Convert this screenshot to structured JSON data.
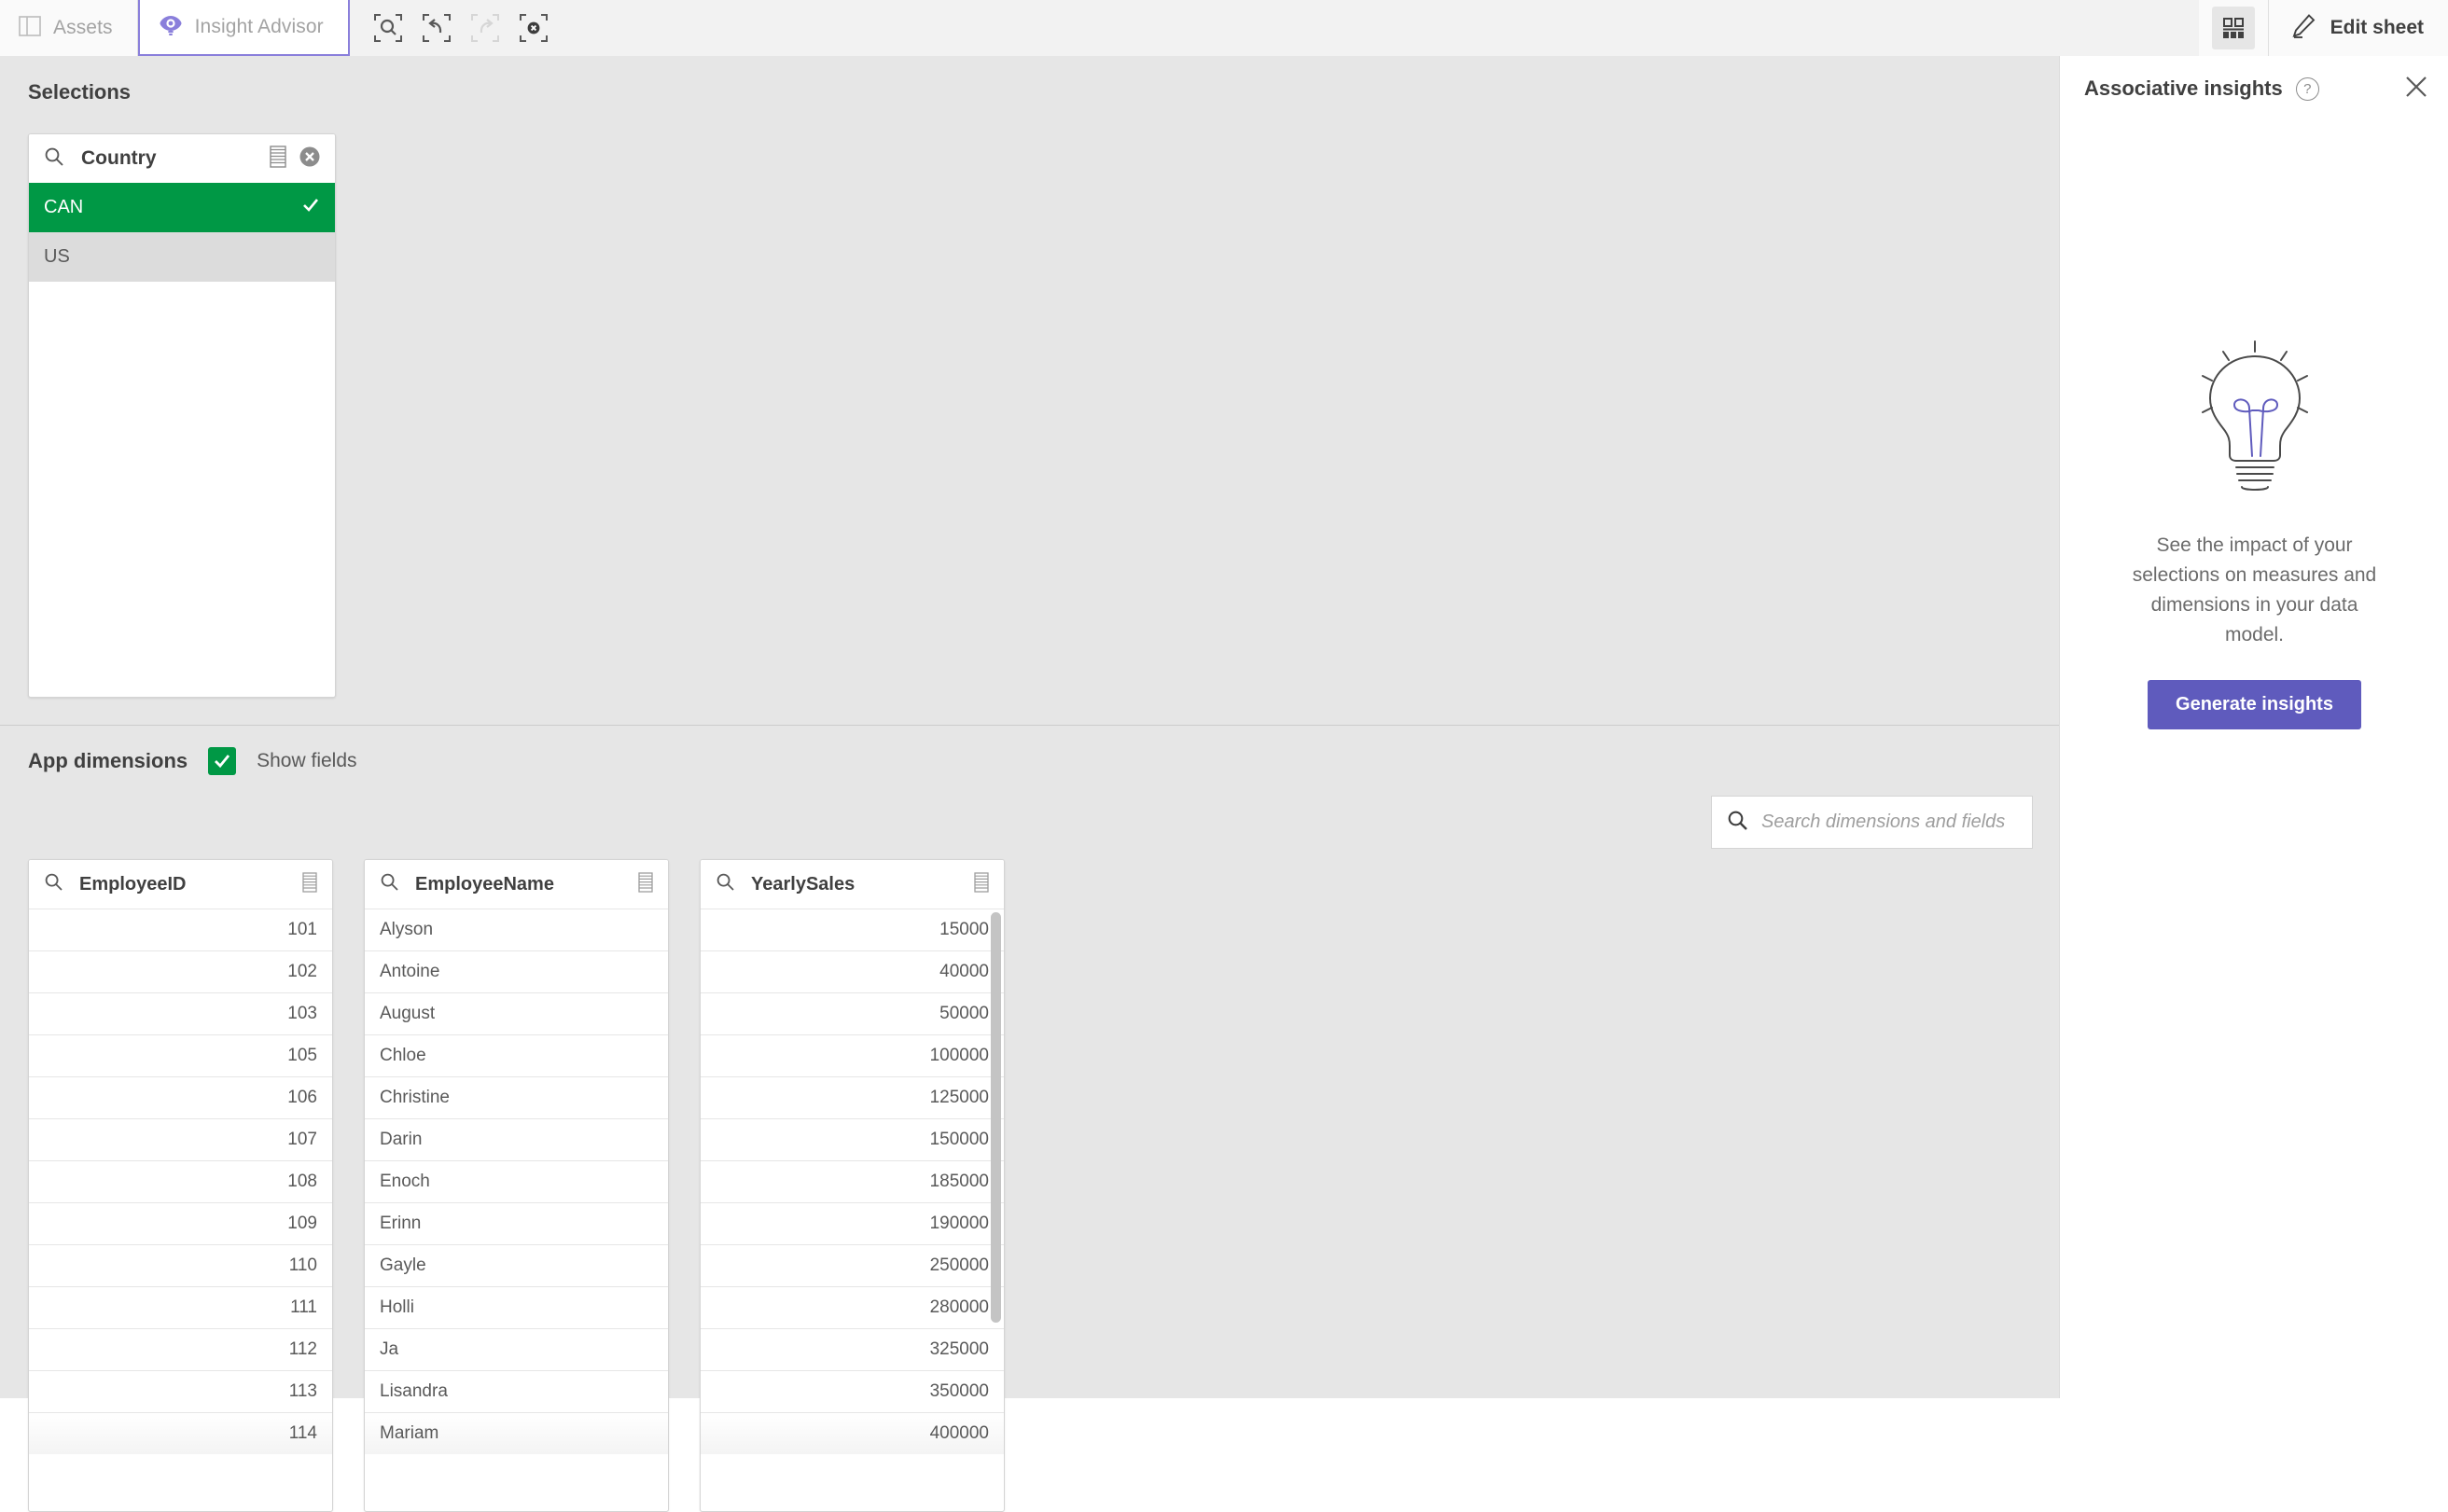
{
  "toolbar": {
    "tabs": [
      {
        "label": "Assets",
        "icon": "panel-icon",
        "active": false
      },
      {
        "label": "Insight Advisor",
        "icon": "insight-advisor-icon",
        "active": true
      }
    ],
    "selection_actions": [
      {
        "name": "selection-search",
        "icon": "search-in-selection-icon",
        "enabled": true
      },
      {
        "name": "step-back",
        "icon": "undo-icon",
        "enabled": true
      },
      {
        "name": "step-forward",
        "icon": "redo-icon",
        "enabled": false
      },
      {
        "name": "clear-selections",
        "icon": "clear-all-icon",
        "enabled": true
      }
    ],
    "sheet_grid_label": "sheet-grid-icon",
    "edit_sheet_label": "Edit sheet",
    "edit_sheet_icon": "pencil-icon"
  },
  "selections": {
    "title": "Selections",
    "field": {
      "name": "Country",
      "search_icon": "search-icon",
      "menu_icon": "listbox-menu-icon",
      "clear_icon": "clear-selection-icon",
      "values": [
        {
          "label": "CAN",
          "state": "selected",
          "check_icon": "check-icon"
        },
        {
          "label": "US",
          "state": "excluded",
          "check_icon": ""
        }
      ]
    }
  },
  "app_dimensions": {
    "title": "App dimensions",
    "show_fields_label": "Show fields",
    "show_fields_checked": true,
    "search": {
      "placeholder": "Search dimensions and fields",
      "value": "",
      "icon": "search-icon"
    },
    "listboxes": [
      {
        "name": "EmployeeID",
        "align": "right",
        "has_scrollbar": false,
        "values": [
          "101",
          "102",
          "103",
          "105",
          "106",
          "107",
          "108",
          "109",
          "110",
          "111",
          "112",
          "113",
          "114"
        ]
      },
      {
        "name": "EmployeeName",
        "align": "left",
        "has_scrollbar": false,
        "values": [
          "Alyson",
          "Antoine",
          "August",
          "Chloe",
          "Christine",
          "Darin",
          "Enoch",
          "Erinn",
          "Gayle",
          "Holli",
          "Ja",
          "Lisandra",
          "Mariam"
        ]
      },
      {
        "name": "YearlySales",
        "align": "right",
        "has_scrollbar": true,
        "values": [
          "15000",
          "40000",
          "50000",
          "100000",
          "125000",
          "150000",
          "185000",
          "190000",
          "250000",
          "280000",
          "325000",
          "350000",
          "400000"
        ]
      }
    ]
  },
  "associative_insights": {
    "title": "Associative insights",
    "help_label": "?",
    "close_icon": "close-icon",
    "illustration": "lightbulb-icon",
    "description": "See the impact of your selections on measures and dimensions in your data model.",
    "generate_button": "Generate insights"
  },
  "colors": {
    "selected_green": "#009845",
    "accent_purple": "#5f5bbd",
    "tab_purple": "#8a7fdb",
    "canvas_gray": "#e6e6e6",
    "text_dark": "#404040",
    "text_muted": "#595959"
  }
}
